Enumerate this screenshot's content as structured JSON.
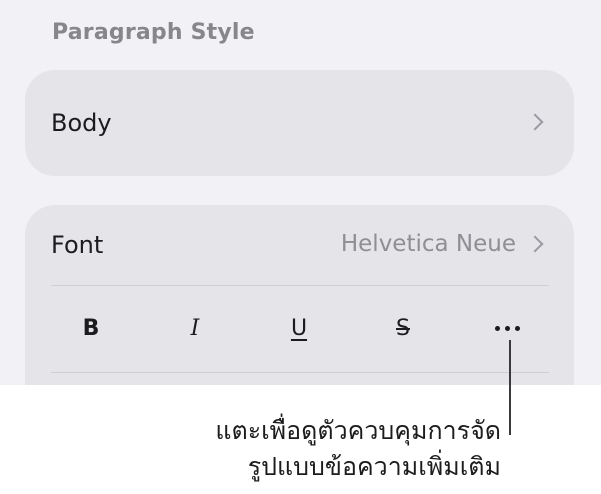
{
  "paragraph_style": {
    "title": "Paragraph Style",
    "value": "Body"
  },
  "font": {
    "label": "Font",
    "value": "Helvetica Neue"
  },
  "format_buttons": {
    "bold": "B",
    "italic": "I",
    "underline": "U",
    "strikethrough": "S"
  },
  "icons": {
    "style_row": "chevron-right-icon",
    "font_row": "chevron-right-icon",
    "more": "ellipsis-icon"
  },
  "callout": {
    "line1": "แตะเพื่อดูตัวควบคุมการจัด",
    "line2": "รูปแบบข้อความเพิ่มเติม"
  }
}
